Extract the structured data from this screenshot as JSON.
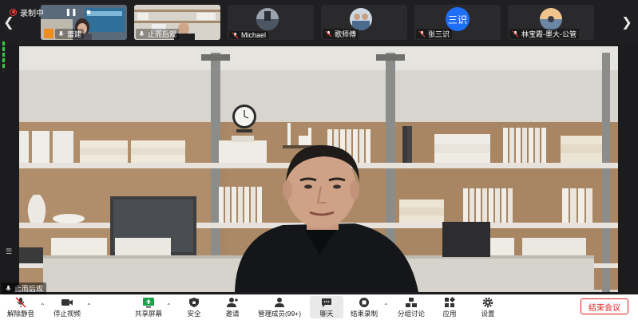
{
  "recording": {
    "status": "录制中"
  },
  "thumbnails": [
    {
      "name": "蕾建",
      "kind": "video"
    },
    {
      "name": "止而后观",
      "kind": "video"
    },
    {
      "name": "Michael",
      "kind": "avatar"
    },
    {
      "name": "歌师傅",
      "kind": "avatar"
    },
    {
      "name": "张三识",
      "kind": "text-avatar",
      "avatar_text": "三识"
    },
    {
      "name": "林宝霞-墨大-公管",
      "kind": "avatar"
    }
  ],
  "main_speaker": {
    "name": "止而后观"
  },
  "toolbar": {
    "mute": "解除静音",
    "video": "停止视频",
    "share": "共享屏幕",
    "security": "安全",
    "invite": "邀请",
    "participants": "管理成员(99+)",
    "chat": "聊天",
    "record": "结束录制",
    "breakout": "分组讨论",
    "apps": "应用",
    "settings": "设置",
    "end": "结束会议"
  },
  "colors": {
    "end_red": "#e02020",
    "accent_blue": "#1e6ef5",
    "rec_red": "#ff3b30"
  }
}
